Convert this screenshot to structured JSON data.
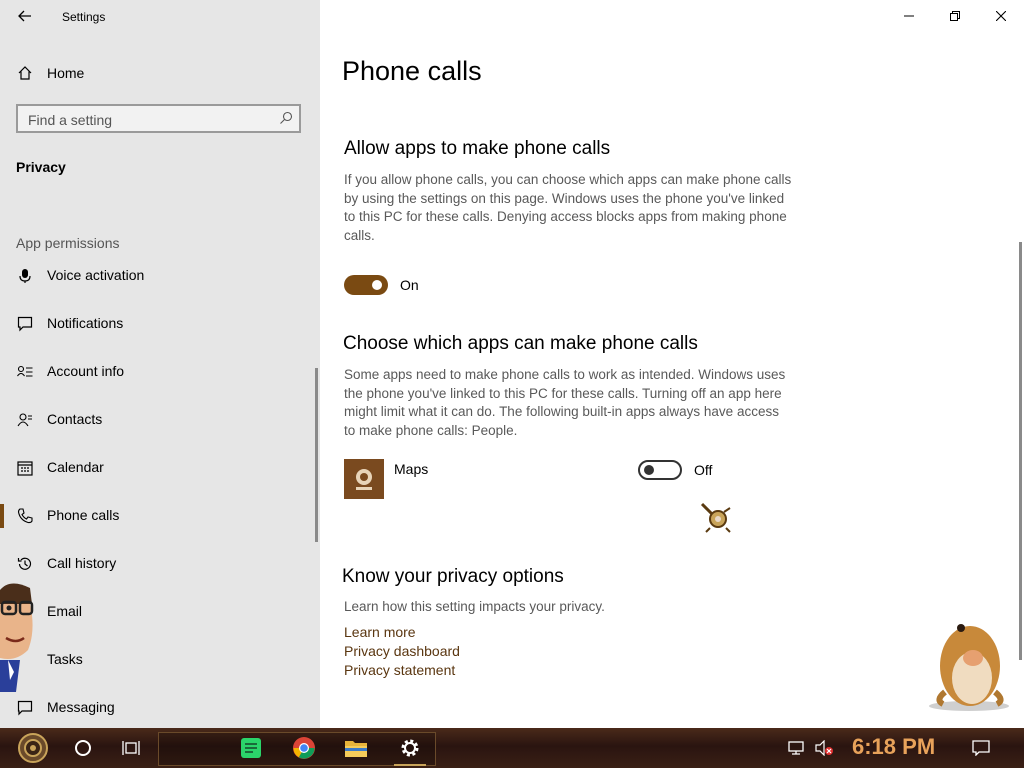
{
  "window": {
    "title": "Settings"
  },
  "sidebar": {
    "home_label": "Home",
    "search_placeholder": "Find a setting",
    "category": "Privacy",
    "section_label": "App permissions",
    "items": [
      {
        "label": "Voice activation",
        "icon": "microphone-icon"
      },
      {
        "label": "Notifications",
        "icon": "notification-icon"
      },
      {
        "label": "Account info",
        "icon": "account-info-icon"
      },
      {
        "label": "Contacts",
        "icon": "contacts-icon"
      },
      {
        "label": "Calendar",
        "icon": "calendar-icon"
      },
      {
        "label": "Phone calls",
        "icon": "phone-icon",
        "active": true
      },
      {
        "label": "Call history",
        "icon": "history-icon"
      },
      {
        "label": "Email",
        "icon": "email-icon"
      },
      {
        "label": "Tasks",
        "icon": "tasks-icon"
      },
      {
        "label": "Messaging",
        "icon": "messaging-icon"
      }
    ]
  },
  "main": {
    "title": "Phone calls",
    "allow": {
      "heading": "Allow apps to make phone calls",
      "description": "If you allow phone calls, you can choose which apps can make phone calls by using the settings on this page. Windows uses the phone you've linked to this PC for these calls. Denying access blocks apps from making phone calls.",
      "toggle_state": "On"
    },
    "choose": {
      "heading": "Choose which apps can make phone calls",
      "description": "Some apps need to make phone calls to work as intended. Windows uses the phone you've linked to this PC for these calls. Turning off an app here might limit what it can do. The following built-in apps always have access to make phone calls: People.",
      "apps": [
        {
          "name": "Maps",
          "state": "Off"
        }
      ]
    },
    "privacy": {
      "heading": "Know your privacy options",
      "description": "Learn how this setting impacts your privacy.",
      "links": [
        "Learn more",
        "Privacy dashboard",
        "Privacy statement"
      ]
    }
  },
  "taskbar": {
    "time": "6:18 PM"
  },
  "colors": {
    "accent": "#7a4a12",
    "sidebar_bg": "#e6e6e6",
    "link": "#5a3610",
    "clock": "#e8a25a"
  }
}
